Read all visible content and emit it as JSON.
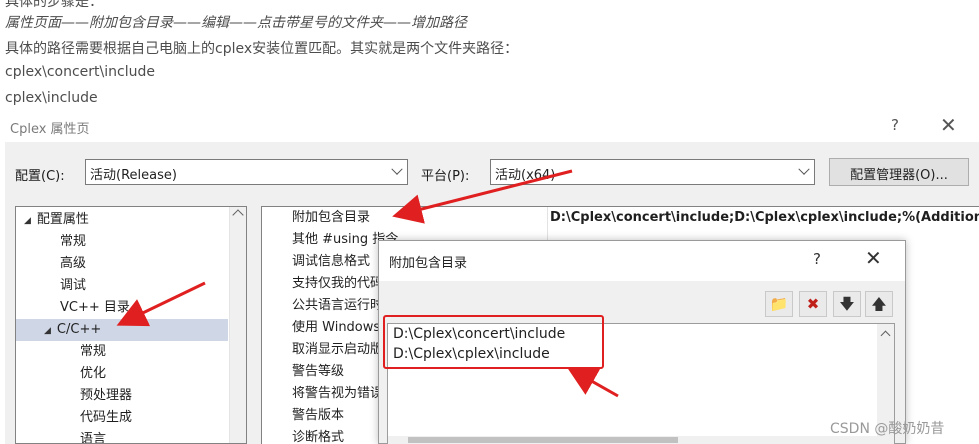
{
  "article": {
    "line0": "具体的步骤是：",
    "line1": "属性页面——附加包含目录——编辑——点击带星号的文件夹——增加路径",
    "line2": "具体的路径需要根据自己电脑上的cplex安装位置匹配。其实就是两个文件夹路径：",
    "line3": "cplex\\concert\\include",
    "line4": "cplex\\include"
  },
  "dialog": {
    "title": "Cplex 属性页",
    "help": "?",
    "close": "✕",
    "config_label": "配置(C):",
    "config_value": "活动(Release)",
    "platform_label": "平台(P):",
    "platform_value": "活动(x64)",
    "config_manager": "配置管理器(O)..."
  },
  "tree": [
    {
      "label": "配置属性",
      "caret": "◢"
    },
    {
      "label": "常规"
    },
    {
      "label": "高级"
    },
    {
      "label": "调试"
    },
    {
      "label": "VC++ 目录"
    },
    {
      "label": "C/C++",
      "caret": "◢"
    },
    {
      "label": "常规"
    },
    {
      "label": "优化"
    },
    {
      "label": "预处理器"
    },
    {
      "label": "代码生成"
    },
    {
      "label": "语言"
    }
  ],
  "grid": {
    "rows": [
      "附加包含目录",
      "其他 #using 指令",
      "调试信息格式",
      "支持仅我的代码调试",
      "公共语言运行时支持",
      "使用 Windows 运行时扩展",
      "取消显示启动版权标志",
      "警告等级",
      "将警告视为错误",
      "警告版本",
      "诊断格式"
    ],
    "value": "D:\\Cplex\\concert\\include;D:\\Cplex\\cplex\\include;%(AdditionalIncludeDirectories)"
  },
  "subdialog": {
    "title": "附加包含目录",
    "help": "?",
    "close": "✕",
    "toolbar": {
      "new_folder": "📁",
      "delete": "✖",
      "down": "🡇",
      "up": "🡅"
    },
    "paths": [
      "D:\\Cplex\\concert\\include",
      "D:\\Cplex\\cplex\\include"
    ]
  },
  "watermark": "CSDN @酸奶奶昔",
  "colors": {
    "annotation_red": "#e02020",
    "tree_selection": "#cfd6e5"
  }
}
